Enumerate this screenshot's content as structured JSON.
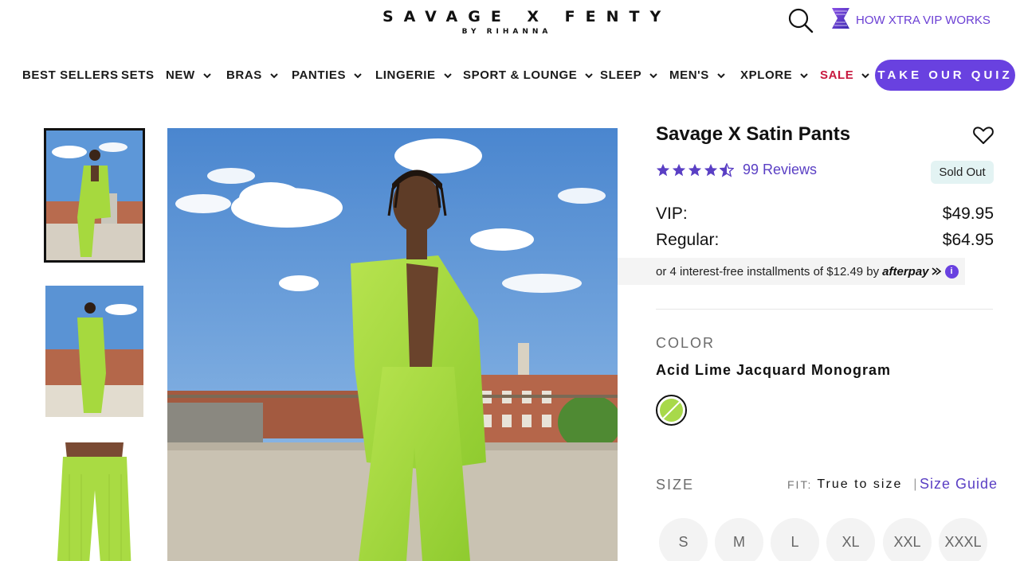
{
  "header": {
    "logo_main": "SAVAGE X FENTY",
    "logo_sub": "BY RIHANNA",
    "vip_link": "HOW XTRA VIP WORKS",
    "icons": {
      "search": "search-icon",
      "vip": "vip-x-logo-icon",
      "chevron": "chevron-down-icon"
    }
  },
  "nav": {
    "items": [
      {
        "label": "BEST SELLERS",
        "has_chevron": false
      },
      {
        "label": "SETS",
        "has_chevron": false
      },
      {
        "label": "NEW",
        "has_chevron": true
      },
      {
        "label": "BRAS",
        "has_chevron": true
      },
      {
        "label": "PANTIES",
        "has_chevron": true
      },
      {
        "label": "LINGERIE",
        "has_chevron": true
      },
      {
        "label": "SPORT & LOUNGE",
        "has_chevron": true
      },
      {
        "label": "SLEEP",
        "has_chevron": true
      },
      {
        "label": "MEN'S",
        "has_chevron": true
      },
      {
        "label": "XPLORE",
        "has_chevron": true
      },
      {
        "label": "SALE",
        "has_chevron": true
      }
    ],
    "quiz_button": "TAKE OUR QUIZ",
    "sale_color": "#c8193f",
    "accent_color": "#6941e0"
  },
  "gallery": {
    "thumbnails": [
      {
        "name": "thumbnail-front-view",
        "active": true
      },
      {
        "name": "thumbnail-back-view",
        "active": false
      },
      {
        "name": "thumbnail-closeup-view",
        "active": false
      }
    ]
  },
  "product": {
    "title": "Savage X Satin Pants",
    "rating": 4.5,
    "reviews": "99 Reviews",
    "status_badge": "Sold Out",
    "vip_label": "VIP:",
    "vip_price": "$49.95",
    "regular_label": "Regular:",
    "regular_price": "$64.95",
    "afterpay_text": "or 4 interest-free installments of $12.49 by",
    "afterpay_brand": "afterpay",
    "afterpay_info": "i",
    "color_heading": "COLOR",
    "color_name": "Acid Lime Jacquard Monogram",
    "color_hex": "#a8d94a",
    "size_heading": "SIZE",
    "fit_label": "FIT:",
    "fit_value": "True to size",
    "fit_separator": "|",
    "size_guide": "Size Guide",
    "sizes": [
      "S",
      "M",
      "L",
      "XL",
      "XXL",
      "XXXL"
    ]
  }
}
